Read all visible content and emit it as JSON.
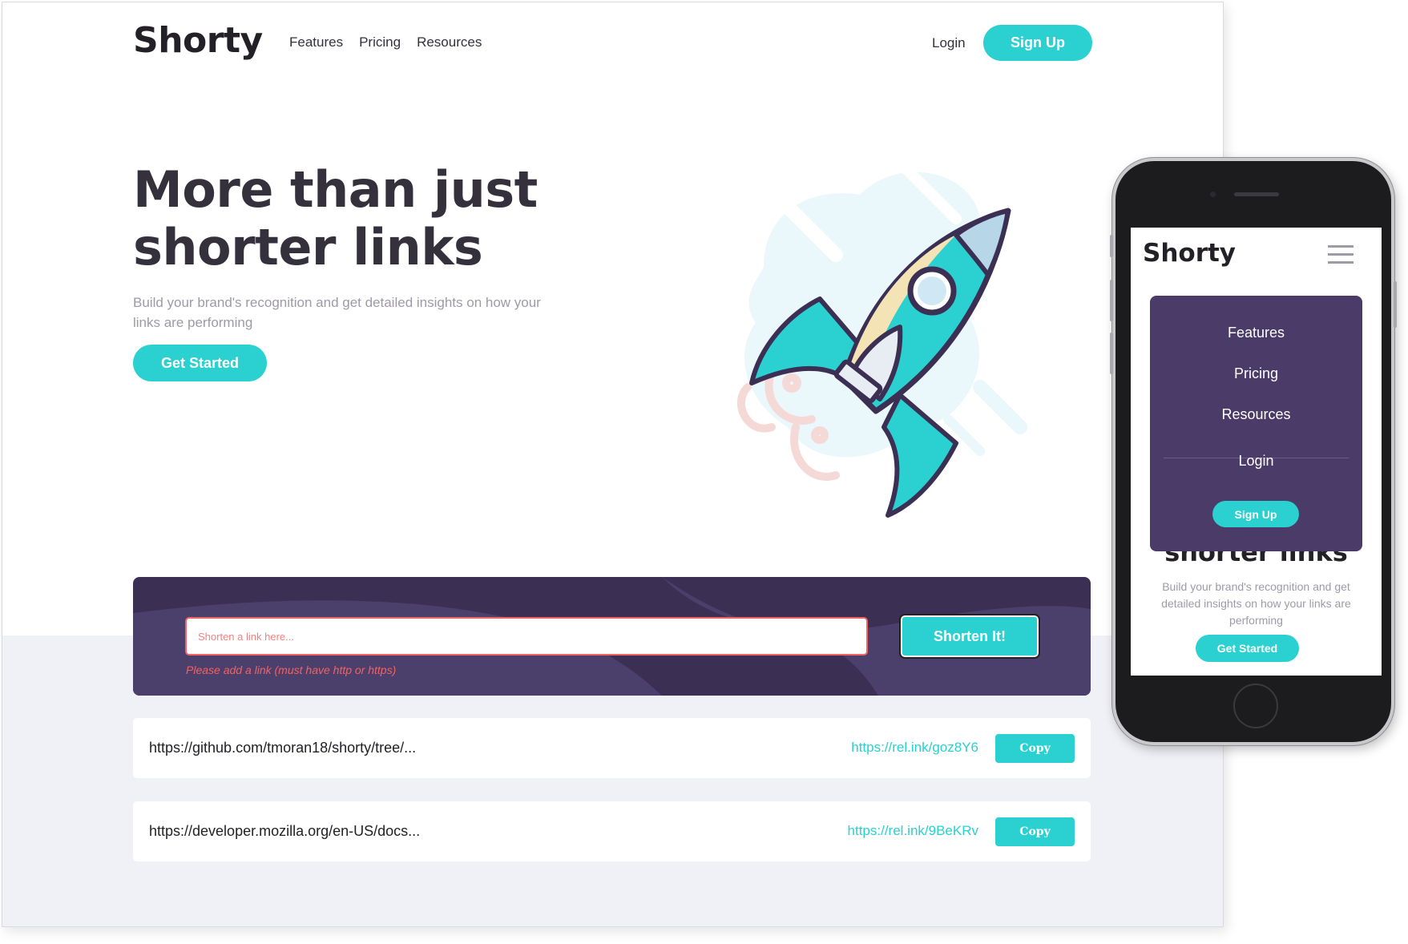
{
  "brand": {
    "logo": "Shorty",
    "accent": "#2bd0d0",
    "dark_violet": "#3b3054",
    "error": "#f46262"
  },
  "nav": {
    "links": [
      "Features",
      "Pricing",
      "Resources"
    ],
    "login": "Login",
    "signup": "Sign Up"
  },
  "hero": {
    "title": "More than just shorter links",
    "subtitle": "Build your brand's recognition and get detailed insights on how your links are performing",
    "cta": "Get Started",
    "illustration_icon": "rocket-icon"
  },
  "shorten": {
    "placeholder": "Shorten a link here...",
    "error": "Please add a link (must have http or https)",
    "button": "Shorten It!"
  },
  "results": [
    {
      "original": "https://github.com/tmoran18/shorty/tree/...",
      "short": "https://rel.ink/goz8Y6",
      "copy": "Copy"
    },
    {
      "original": "https://developer.mozilla.org/en-US/docs...",
      "short": "https://rel.ink/9BeKRv",
      "copy": "Copy"
    }
  ],
  "mobile": {
    "logo": "Shorty",
    "menu_icon": "hamburger-icon",
    "menu": {
      "items": [
        "Features",
        "Pricing",
        "Resources"
      ],
      "login": "Login",
      "signup": "Sign Up"
    },
    "title_peek": "shorter links",
    "subtitle": "Build your brand's recognition and get detailed insights on how your links are performing",
    "cta": "Get Started"
  }
}
